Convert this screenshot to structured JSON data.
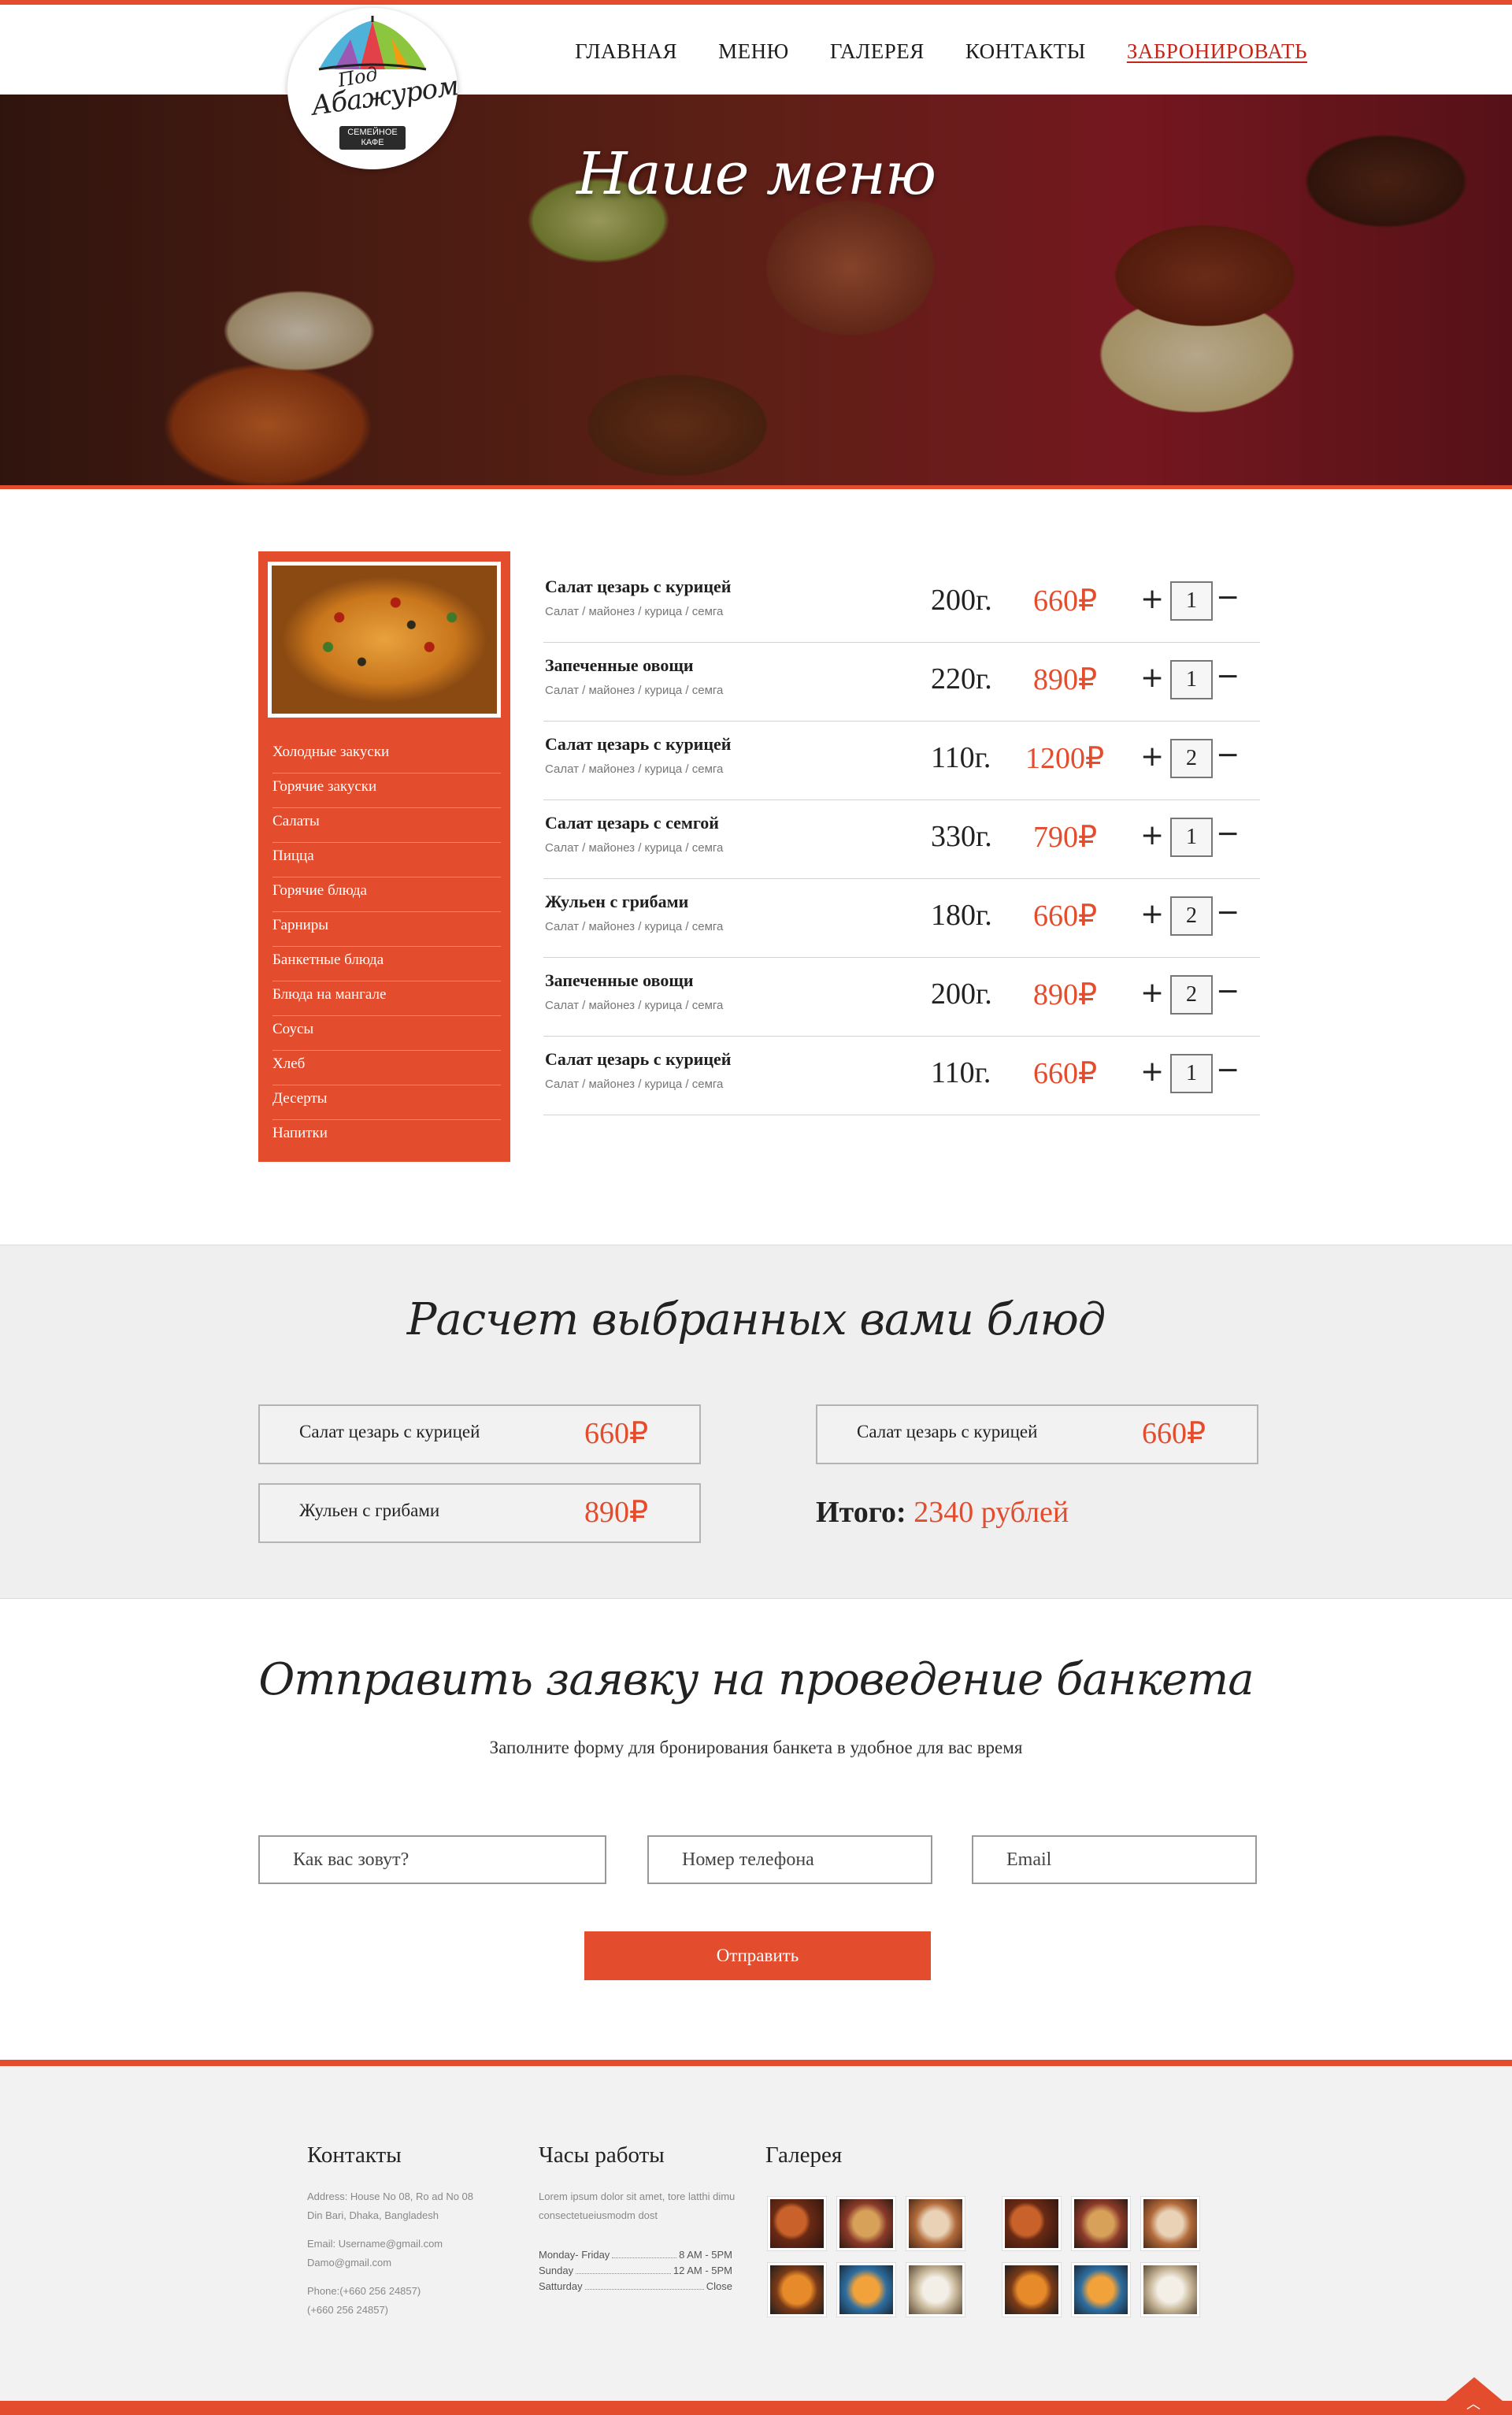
{
  "nav": {
    "items": [
      "ГЛАВНАЯ",
      "МЕНЮ",
      "ГАЛЕРЕЯ",
      "КОНТАКТЫ"
    ],
    "booking": "ЗАБРОНИРОВАТЬ"
  },
  "logo": {
    "pod": "Под",
    "name": "Абажуром",
    "badge": "СЕМЕЙНОЕ КАФЕ"
  },
  "hero": {
    "title": "Наше меню"
  },
  "sidebar": {
    "categories": [
      "Холодные закуски",
      "Горячие закуски",
      "Салаты",
      "Пицца",
      "Горячие блюда",
      "Гарниры",
      "Банкетные блюда",
      "Блюда на мангале",
      "Соусы",
      "Хлеб",
      "Десерты",
      "Напитки"
    ]
  },
  "menu": {
    "items": [
      {
        "name": "Салат цезарь с курицей",
        "desc": "Салат / майонез / курица / семга",
        "weight": "200г.",
        "price": "660₽",
        "qty": "1"
      },
      {
        "name": "Запеченные овощи",
        "desc": "Салат / майонез / курица / семга",
        "weight": "220г.",
        "price": "890₽",
        "qty": "1"
      },
      {
        "name": "Салат цезарь с курицей",
        "desc": "Салат / майонез / курица / семга",
        "weight": "110г.",
        "price": "1200₽",
        "qty": "2"
      },
      {
        "name": "Салат цезарь с семгой",
        "desc": "Салат / майонез / курица / семга",
        "weight": "330г.",
        "price": "790₽",
        "qty": "1"
      },
      {
        "name": "Жульен с грибами",
        "desc": "Салат / майонез / курица / семга",
        "weight": "180г.",
        "price": "660₽",
        "qty": "2"
      },
      {
        "name": "Запеченные овощи",
        "desc": "Салат / майонез / курица / семга",
        "weight": "200г.",
        "price": "890₽",
        "qty": "2"
      },
      {
        "name": "Салат цезарь с курицей",
        "desc": "Салат / майонез / курица / семга",
        "weight": "110г.",
        "price": "660₽",
        "qty": "1"
      }
    ],
    "plus": "+",
    "minus": "−"
  },
  "calc": {
    "title": "Расчет выбранных вами блюд",
    "cards": [
      {
        "name": "Салат цезарь с курицей",
        "price": "660₽"
      },
      {
        "name": "Салат цезарь с курицей",
        "price": "660₽"
      },
      {
        "name": "Жульен с грибами",
        "price": "890₽"
      }
    ],
    "total_label": "Итого:",
    "total_value": "2340 рублей"
  },
  "request": {
    "title": "Отправить заявку на проведение банкета",
    "subtitle": "Заполните форму для бронирования банкета в удобное для вас время",
    "name_placeholder": "Как вас зовут?",
    "phone_placeholder": "Номер телефона",
    "email_placeholder": "Email",
    "submit": "Отправить"
  },
  "footer": {
    "contacts": {
      "title": "Контакты",
      "address": "Address: House No 08, Ro ad No 08 Din Bari, Dhaka, Bangladesh",
      "email_1": "Email: Username@gmail.com",
      "email_2": "Damo@gmail.com",
      "phone_1": "Phone:(+660 256 24857)",
      "phone_2": "(+660 256 24857)"
    },
    "hours": {
      "title": "Часы работы",
      "intro": "Lorem ipsum dolor sit amet, tore latthi dimu consectetueiusmodm dost",
      "rows": [
        {
          "day": "Monday- Friday",
          "time": "8 AM - 5PM"
        },
        {
          "day": "Sunday",
          "time": "12 AM - 5PM"
        },
        {
          "day": "Satturday",
          "time": "Close"
        }
      ]
    },
    "gallery": {
      "title": "Галерея"
    }
  },
  "colors": {
    "accent": "#e34c2d",
    "booking_link": "#c3261a",
    "calc_background": "#efefef",
    "footer_background": "#f2f2f2"
  },
  "icons": [
    "plus-icon",
    "minus-icon",
    "scroll-top-icon"
  ]
}
